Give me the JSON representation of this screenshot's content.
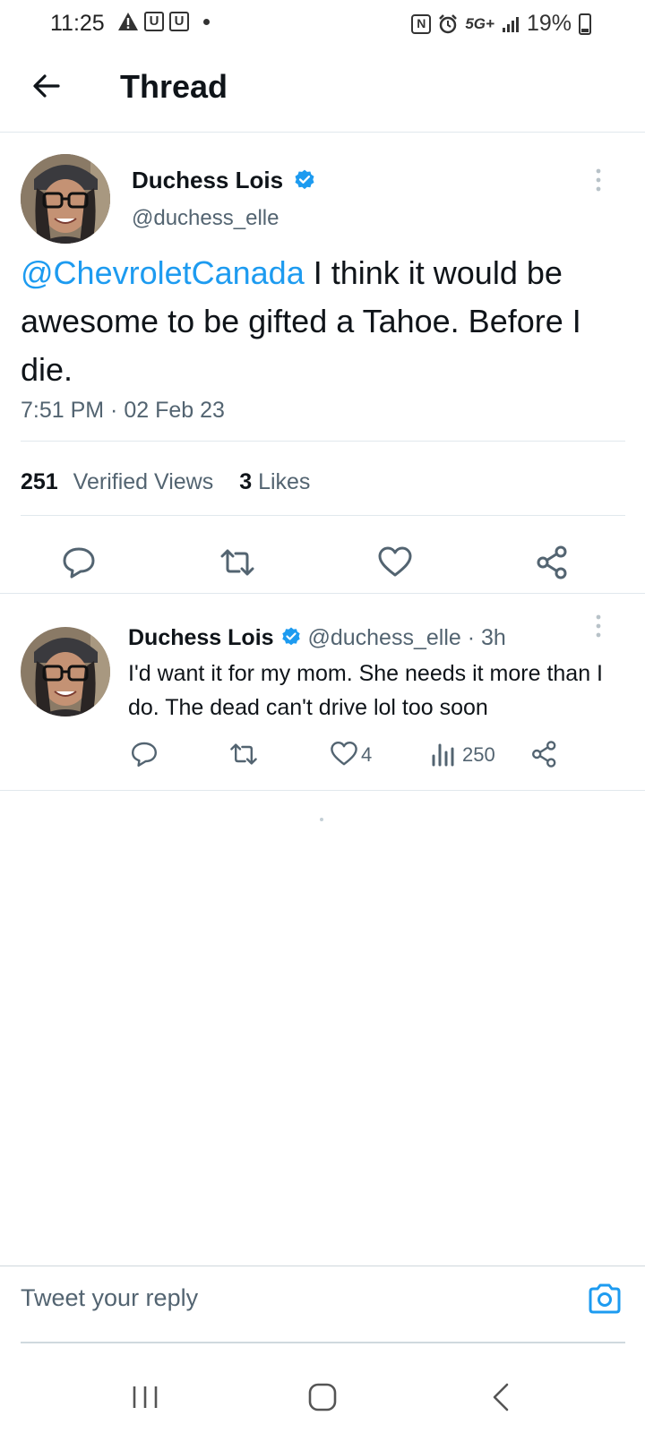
{
  "status_bar": {
    "time": "11:25",
    "left_icons": [
      "warning-icon",
      "u-box-icon",
      "u-box-icon"
    ],
    "u_label": "U",
    "network": "5G+",
    "nfc_label": "N",
    "battery": "19%"
  },
  "header": {
    "title": "Thread"
  },
  "main_tweet": {
    "author_name": "Duchess Lois",
    "handle": "@duchess_elle",
    "mention": "@ChevroletCanada",
    "text": " I think it would be awesome to be gifted a Tahoe. Before I die.",
    "timestamp": "7:51 PM · 02 Feb 23",
    "views_count": "251",
    "views_label": "Verified Views",
    "likes_count": "3",
    "likes_label": "Likes"
  },
  "reply": {
    "author_name": "Duchess Lois",
    "handle_time": "@duchess_elle · 3h",
    "text": "I'd want it for my mom. She needs it more than I do. The dead can't drive lol too soon",
    "like_count": "4",
    "view_count": "250"
  },
  "composer": {
    "placeholder": "Tweet your reply"
  },
  "colors": {
    "accent": "#1d9bf0",
    "secondary_text": "#536471",
    "primary_text": "#0f1419"
  }
}
